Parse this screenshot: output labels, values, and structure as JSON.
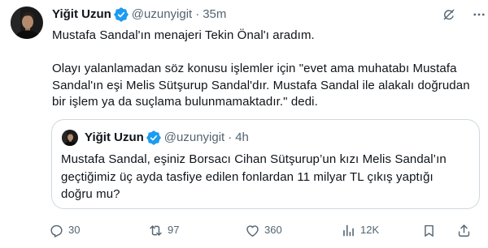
{
  "colors": {
    "text": "#0f1419",
    "secondary": "#536471",
    "verified": "#1d9bf0",
    "border": "#cfd9de"
  },
  "tweet": {
    "author": {
      "name": "Yiğit Uzun",
      "handle": "@uzunyigit",
      "separator": "·",
      "time": "35m",
      "verified": true
    },
    "header_icons": {
      "grok": "grok-icon",
      "more": "more-icon"
    },
    "text": [
      "Mustafa Sandal'ın menajeri Tekin Önal'ı aradım.",
      "Olayı yalanlamadan söz konusu işlemler için \"evet ama muhatabı Mustafa Sandal'ın eşi Melis Sütşurup Sandal'dır. Mustafa Sandal ile alakalı doğrudan bir işlem ya da suçlama bulunmamaktadır.\" dedi."
    ]
  },
  "quote": {
    "author": {
      "name": "Yiğit Uzun",
      "handle": "@uzunyigit",
      "separator": "·",
      "time": "4h",
      "verified": true
    },
    "text": "Mustafa Sandal, eşiniz Borsacı Cihan Sütşurup’un kızı Melis Sandal’ın geçtiğimiz üç ayda tasfiye edilen fonlardan 11 milyar TL çıkış yaptığı doğru mu?"
  },
  "actions": {
    "reply": {
      "icon": "reply-icon",
      "count": "30"
    },
    "retweet": {
      "icon": "retweet-icon",
      "count": "97"
    },
    "like": {
      "icon": "heart-icon",
      "count": "360"
    },
    "views": {
      "icon": "views-icon",
      "count": "12K"
    },
    "bookmark": {
      "icon": "bookmark-icon"
    },
    "share": {
      "icon": "share-icon"
    }
  }
}
